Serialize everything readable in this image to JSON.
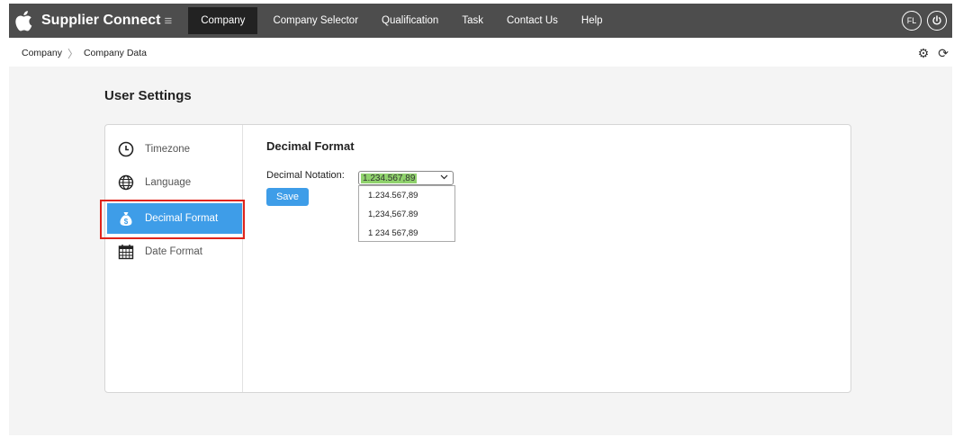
{
  "header": {
    "app_name": "Supplier Connect",
    "hamburger": "≡",
    "nav": [
      "Company",
      "Company Selector",
      "Qualification",
      "Task",
      "Contact Us",
      "Help"
    ],
    "active_nav": "Company",
    "user_initials": "FL"
  },
  "breadcrumb": {
    "root": "Company",
    "current": "Company Data"
  },
  "page": {
    "title": "User Settings"
  },
  "sidebar": {
    "items": [
      {
        "label": "Timezone",
        "icon": "clock-icon"
      },
      {
        "label": "Language",
        "icon": "globe-icon"
      },
      {
        "label": "Decimal Format",
        "icon": "money-bag-icon",
        "active": true
      },
      {
        "label": "Date Format",
        "icon": "calendar-icon"
      }
    ]
  },
  "content": {
    "section_title": "Decimal Format",
    "field_label": "Decimal Notation:",
    "selected_value": "1.234.567,89",
    "options": [
      "1.234.567,89",
      "1,234,567.89",
      "1 234 567,89"
    ],
    "save_label": "Save"
  },
  "colors": {
    "topbar": "#4d4d4d",
    "accent": "#3e9de8",
    "highlight": "#e0241b",
    "selected_text_bg": "#8fd26c"
  }
}
